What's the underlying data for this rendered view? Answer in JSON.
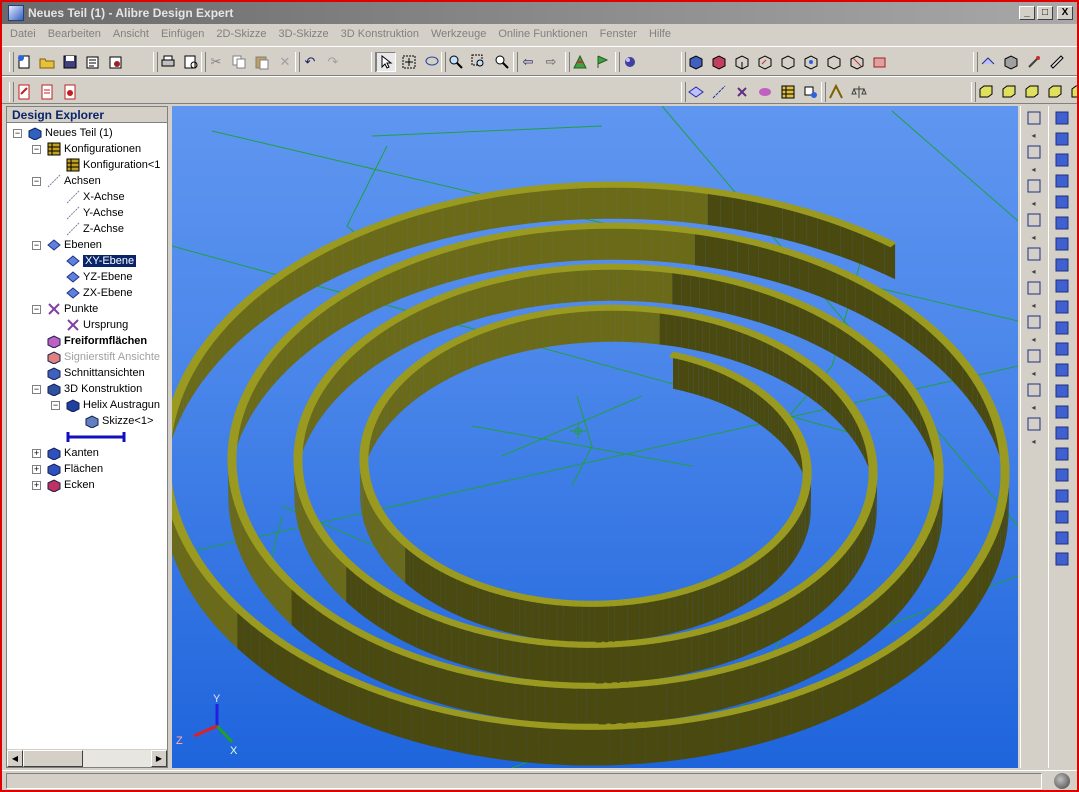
{
  "window": {
    "title": "Neues Teil (1) - Alibre Design Expert",
    "min_label": "_",
    "max_label": "□",
    "close_label": "X"
  },
  "menu": [
    "Datei",
    "Bearbeiten",
    "Ansicht",
    "Einfügen",
    "2D-Skizze",
    "3D-Skizze",
    "3D Konstruktion",
    "Werkzeuge",
    "Online Funktionen",
    "Fenster",
    "Hilfe"
  ],
  "explorer": {
    "title": "Design Explorer",
    "tree": [
      {
        "label": "Neues Teil (1)",
        "level": 0,
        "expander": "−",
        "icon": "part-icon"
      },
      {
        "label": "Konfigurationen",
        "level": 1,
        "expander": "−",
        "icon": "configurations-icon"
      },
      {
        "label": "Konfiguration<1",
        "level": 2,
        "expander": "",
        "icon": "configuration-icon"
      },
      {
        "label": "Achsen",
        "level": 1,
        "expander": "−",
        "icon": "axes-icon"
      },
      {
        "label": "X-Achse",
        "level": 2,
        "expander": "",
        "icon": "axis-icon"
      },
      {
        "label": "Y-Achse",
        "level": 2,
        "expander": "",
        "icon": "axis-icon"
      },
      {
        "label": "Z-Achse",
        "level": 2,
        "expander": "",
        "icon": "axis-icon"
      },
      {
        "label": "Ebenen",
        "level": 1,
        "expander": "−",
        "icon": "planes-icon"
      },
      {
        "label": "XY-Ebene",
        "level": 2,
        "expander": "",
        "icon": "plane-icon",
        "selected": true
      },
      {
        "label": "YZ-Ebene",
        "level": 2,
        "expander": "",
        "icon": "plane-icon"
      },
      {
        "label": "ZX-Ebene",
        "level": 2,
        "expander": "",
        "icon": "plane-icon"
      },
      {
        "label": "Punkte",
        "level": 1,
        "expander": "−",
        "icon": "points-icon"
      },
      {
        "label": "Ursprung",
        "level": 2,
        "expander": "",
        "icon": "origin-icon"
      },
      {
        "label": "Freiformflächen",
        "level": 1,
        "expander": "",
        "icon": "freeform-icon",
        "bold": true
      },
      {
        "label": "Signierstift Ansichte",
        "level": 1,
        "expander": "",
        "icon": "marker-icon",
        "grey": true
      },
      {
        "label": "Schnittansichten",
        "level": 1,
        "expander": "",
        "icon": "section-icon"
      },
      {
        "label": "3D Konstruktion",
        "level": 1,
        "expander": "−",
        "icon": "construction-icon"
      },
      {
        "label": "Helix Austragun",
        "level": 2,
        "expander": "−",
        "icon": "helix-icon"
      },
      {
        "label": "Skizze<1>",
        "level": 3,
        "expander": "",
        "icon": "sketch-icon"
      },
      {
        "label": "",
        "level": 2,
        "expander": "",
        "icon": "end-of-part-icon"
      },
      {
        "label": "Kanten",
        "level": 1,
        "expander": "+",
        "icon": "edges-icon"
      },
      {
        "label": "Flächen",
        "level": 1,
        "expander": "+",
        "icon": "faces-icon"
      },
      {
        "label": "Ecken",
        "level": 1,
        "expander": "+",
        "icon": "vertices-icon"
      }
    ]
  },
  "viewport": {
    "triad_labels": {
      "x": "X",
      "y": "Y",
      "z": "Z"
    },
    "model": "spiral-sweep",
    "colors": {
      "band_face": "#9a9a20",
      "band_side": "#4a4a10",
      "sketch": "#20a040",
      "bg_top": "#5f96f0",
      "bg_bottom": "#1e64dc"
    }
  },
  "toolbar_icons": {
    "row1": [
      "new-icon",
      "open-icon",
      "save-icon",
      "properties-icon",
      "print-icon",
      "cut-icon",
      "copy-icon",
      "paste-icon",
      "delete-icon",
      "undo-icon",
      "redo-icon",
      "select-icon",
      "zoom-icon",
      "pan-icon",
      "rotate-icon"
    ],
    "row2": [
      "pdf-icon",
      "export-icon",
      "import-icon",
      "plane-tool-icon",
      "axis-tool-icon",
      "point-tool-icon",
      "freeform-tool-icon",
      "table-icon",
      "measure-icon",
      "balance-icon"
    ]
  },
  "sketch_tools": [
    "line-icon",
    "plus-icon",
    "construction-line-icon",
    "rect-icon",
    "circle-icon",
    "arc-icon",
    "spline-icon",
    "trim-icon",
    "fillet-icon",
    "point-icon"
  ],
  "feature_tools": [
    "extrude-icon",
    "cut-extrude-icon",
    "revolve-icon",
    "sweep-icon",
    "loft-icon",
    "shell-icon",
    "fillet3d-icon",
    "chamfer-icon",
    "hole-icon",
    "pattern-icon",
    "mirror-icon",
    "function-icon"
  ],
  "status": {
    "text": ""
  }
}
